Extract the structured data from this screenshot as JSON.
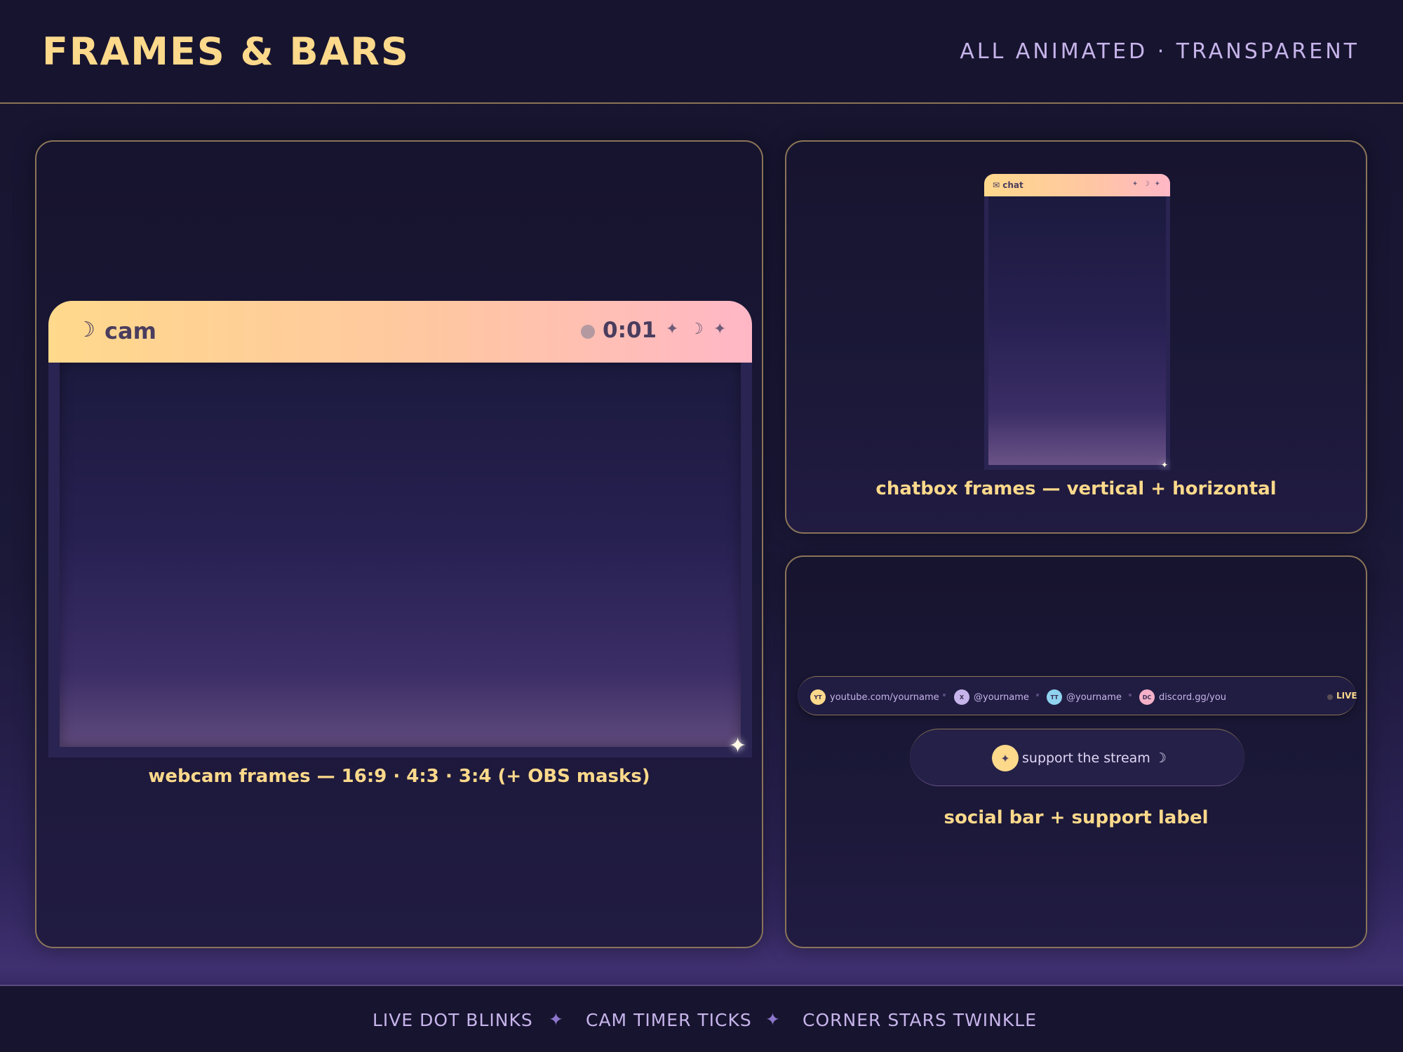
{
  "header": {
    "title": "FRAMES & BARS",
    "subtitle": "ALL ANIMATED · TRANSPARENT"
  },
  "webcam_panel": {
    "bar": {
      "moon_icon": "☽",
      "label": "cam",
      "timer": "0:01",
      "icons": [
        "✦",
        "☽",
        "✦"
      ]
    },
    "caption": "webcam frames — 16:9 · 4:3 · 3:4 (+ OBS masks)"
  },
  "chat_panel": {
    "bar": {
      "label": "✉ chat",
      "icons": "✦ ☽ ✦"
    },
    "caption": "chatbox frames — vertical + horizontal"
  },
  "social_panel": {
    "items": [
      {
        "badge": "YT",
        "text": "youtube.com/yourname",
        "color": "#fcd98b"
      },
      {
        "badge": "X",
        "text": "@yourname",
        "color": "#c6b4ea"
      },
      {
        "badge": "TT",
        "text": "@yourname",
        "color": "#8fd3f0"
      },
      {
        "badge": "DC",
        "text": "discord.gg/you",
        "color": "#f5b0c8"
      }
    ],
    "live_label": "LIVE",
    "support": {
      "star_icon": "✦",
      "text": "support the stream ☽"
    },
    "caption": "social bar + support label"
  },
  "footer": {
    "items": [
      "LIVE DOT BLINKS",
      "CAM TIMER TICKS",
      "CORNER STARS TWINKLE"
    ],
    "separator": "✦"
  },
  "colors": {
    "accent_gold": "#fcd98b",
    "lavender": "#c6b4ea",
    "panel_border": "#8a7558",
    "bar_gradient_start": "#ffd98c",
    "bar_gradient_end": "#ffb7c6"
  }
}
